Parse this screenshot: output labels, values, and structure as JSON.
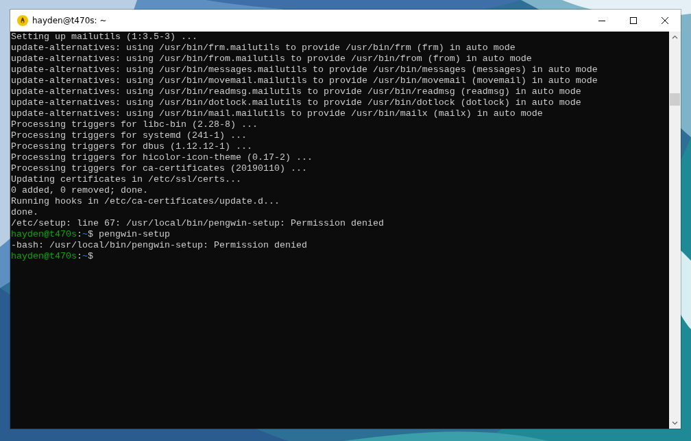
{
  "window": {
    "title": "hayden@t470s: ~"
  },
  "terminal": {
    "lines": [
      {
        "kind": "output",
        "text": "Setting up mailutils (1:3.5-3) ..."
      },
      {
        "kind": "output",
        "text": "update-alternatives: using /usr/bin/frm.mailutils to provide /usr/bin/frm (frm) in auto mode"
      },
      {
        "kind": "output",
        "text": "update-alternatives: using /usr/bin/from.mailutils to provide /usr/bin/from (from) in auto mode"
      },
      {
        "kind": "output",
        "text": "update-alternatives: using /usr/bin/messages.mailutils to provide /usr/bin/messages (messages) in auto mode"
      },
      {
        "kind": "output",
        "text": "update-alternatives: using /usr/bin/movemail.mailutils to provide /usr/bin/movemail (movemail) in auto mode"
      },
      {
        "kind": "output",
        "text": "update-alternatives: using /usr/bin/readmsg.mailutils to provide /usr/bin/readmsg (readmsg) in auto mode"
      },
      {
        "kind": "output",
        "text": "update-alternatives: using /usr/bin/dotlock.mailutils to provide /usr/bin/dotlock (dotlock) in auto mode"
      },
      {
        "kind": "output",
        "text": "update-alternatives: using /usr/bin/mail.mailutils to provide /usr/bin/mailx (mailx) in auto mode"
      },
      {
        "kind": "output",
        "text": "Processing triggers for libc-bin (2.28-8) ..."
      },
      {
        "kind": "output",
        "text": "Processing triggers for systemd (241-1) ..."
      },
      {
        "kind": "output",
        "text": "Processing triggers for dbus (1.12.12-1) ..."
      },
      {
        "kind": "output",
        "text": "Processing triggers for hicolor-icon-theme (0.17-2) ..."
      },
      {
        "kind": "output",
        "text": "Processing triggers for ca-certificates (20190110) ..."
      },
      {
        "kind": "output",
        "text": "Updating certificates in /etc/ssl/certs..."
      },
      {
        "kind": "output",
        "text": "0 added, 0 removed; done."
      },
      {
        "kind": "output",
        "text": "Running hooks in /etc/ca-certificates/update.d..."
      },
      {
        "kind": "output",
        "text": "done."
      },
      {
        "kind": "output",
        "text": "/etc/setup: line 67: /usr/local/bin/pengwin-setup: Permission denied"
      },
      {
        "kind": "prompt",
        "user_host": "hayden@t470s",
        "separator": ":",
        "path": "~",
        "symbol": "$",
        "command": "pengwin-setup"
      },
      {
        "kind": "output",
        "text": "-bash: /usr/local/bin/pengwin-setup: Permission denied"
      },
      {
        "kind": "prompt",
        "user_host": "hayden@t470s",
        "separator": ":",
        "path": "~",
        "symbol": "$"
      }
    ]
  }
}
